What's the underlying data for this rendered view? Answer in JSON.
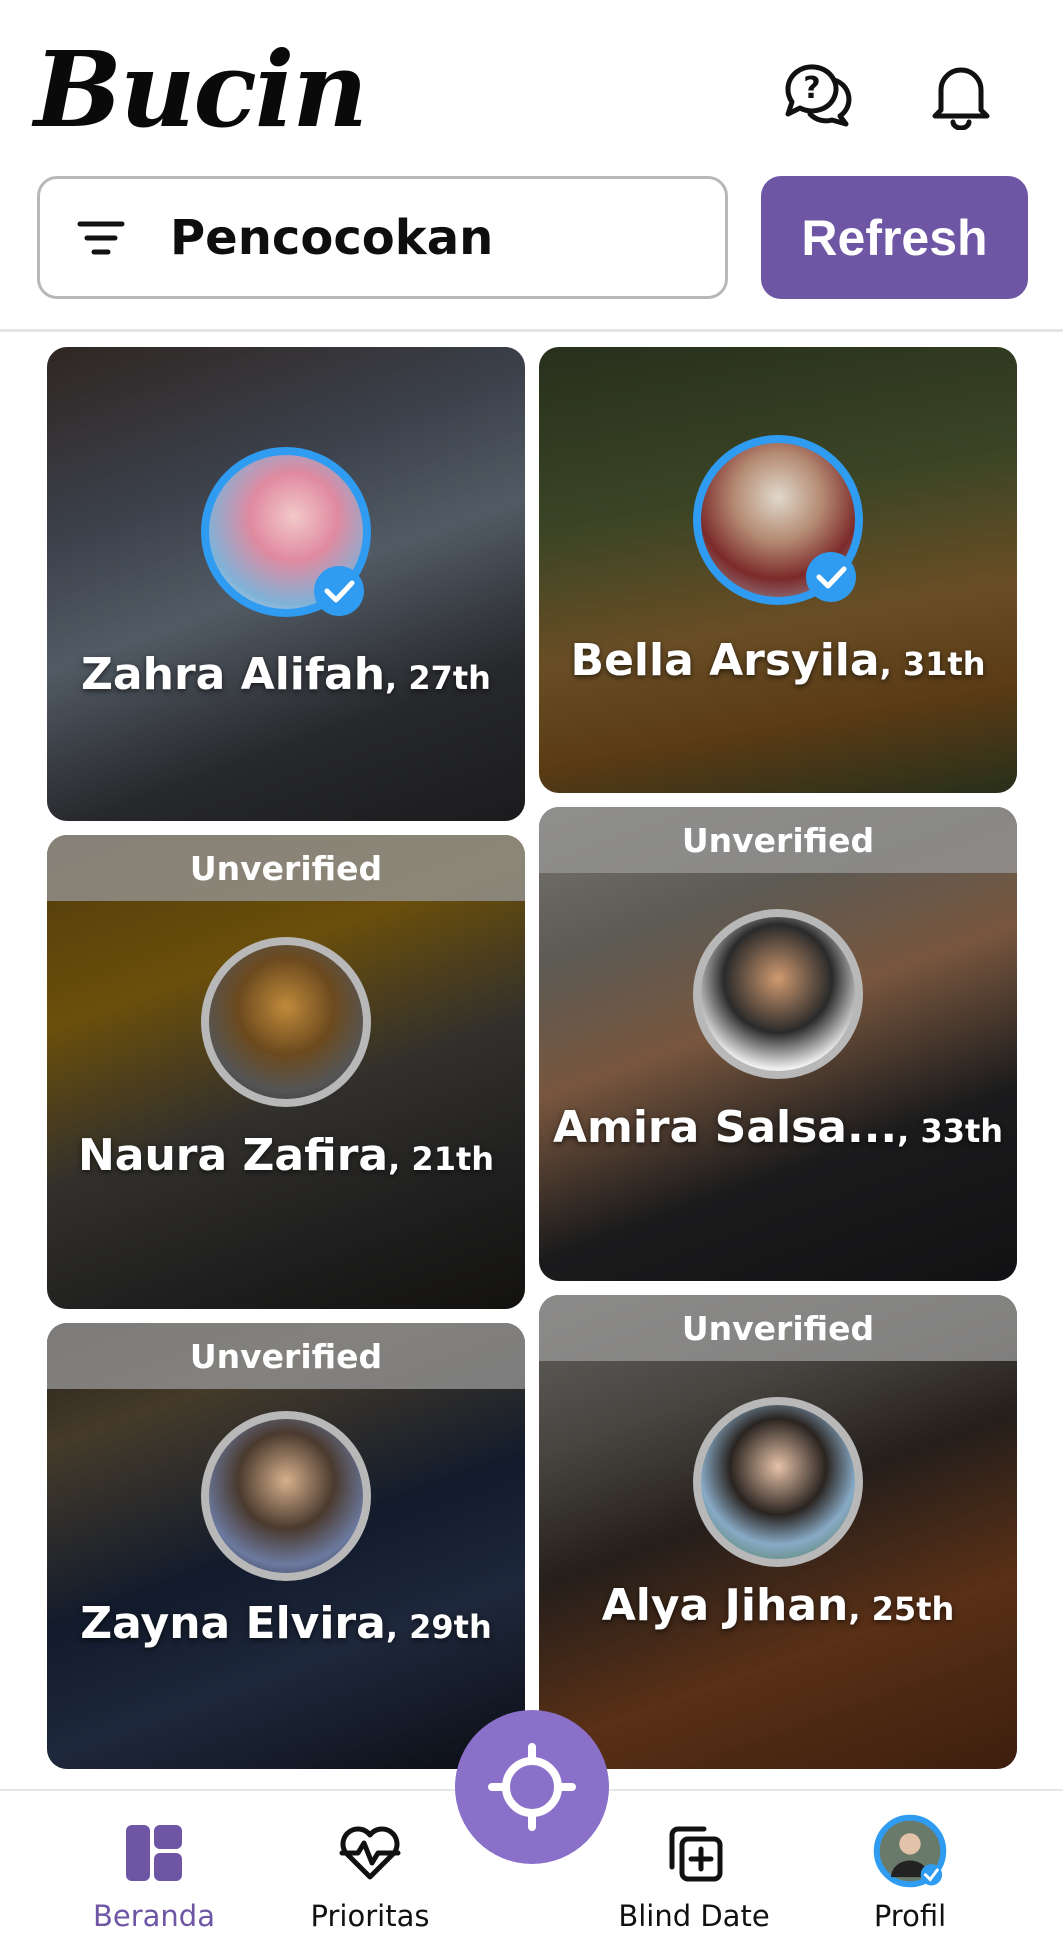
{
  "app": {
    "logo": "Bucin"
  },
  "header": {
    "help_icon": "help-chat-icon",
    "bell_icon": "bell-icon"
  },
  "search": {
    "label": "Pencocokan",
    "icon": "filter-icon"
  },
  "refresh_button": {
    "label": "Refresh",
    "color": "#6e56a5"
  },
  "cards": [
    {
      "name": "Zahra Alifah",
      "age": ", 27th",
      "verified": true,
      "banner": ""
    },
    {
      "name": "Bella Arsyila",
      "age": ", 31th",
      "verified": true,
      "banner": ""
    },
    {
      "name": "Naura Zafira",
      "age": ", 21th",
      "verified": false,
      "banner": "Unverified"
    },
    {
      "name": "Amira Salsa...",
      "age": ", 33th",
      "verified": false,
      "banner": "Unverified"
    },
    {
      "name": "Zayna Elvira",
      "age": ", 29th",
      "verified": false,
      "banner": "Unverified"
    },
    {
      "name": "Alya Jihan",
      "age": ", 25th",
      "verified": false,
      "banner": "Unverified"
    }
  ],
  "nav": {
    "items": [
      {
        "label": "Beranda",
        "icon": "home-grid-icon",
        "active": true
      },
      {
        "label": "Prioritas",
        "icon": "heart-pulse-icon",
        "active": false
      },
      {
        "label": "Blind Date",
        "icon": "add-copy-icon",
        "active": false
      },
      {
        "label": "Profil",
        "icon": "profile-avatar-icon",
        "active": false
      }
    ],
    "fab_icon": "crosshair-icon"
  },
  "colors": {
    "accent": "#6e56a5",
    "verified_ring": "#2f9bf1",
    "fab": "#8a70c9"
  }
}
